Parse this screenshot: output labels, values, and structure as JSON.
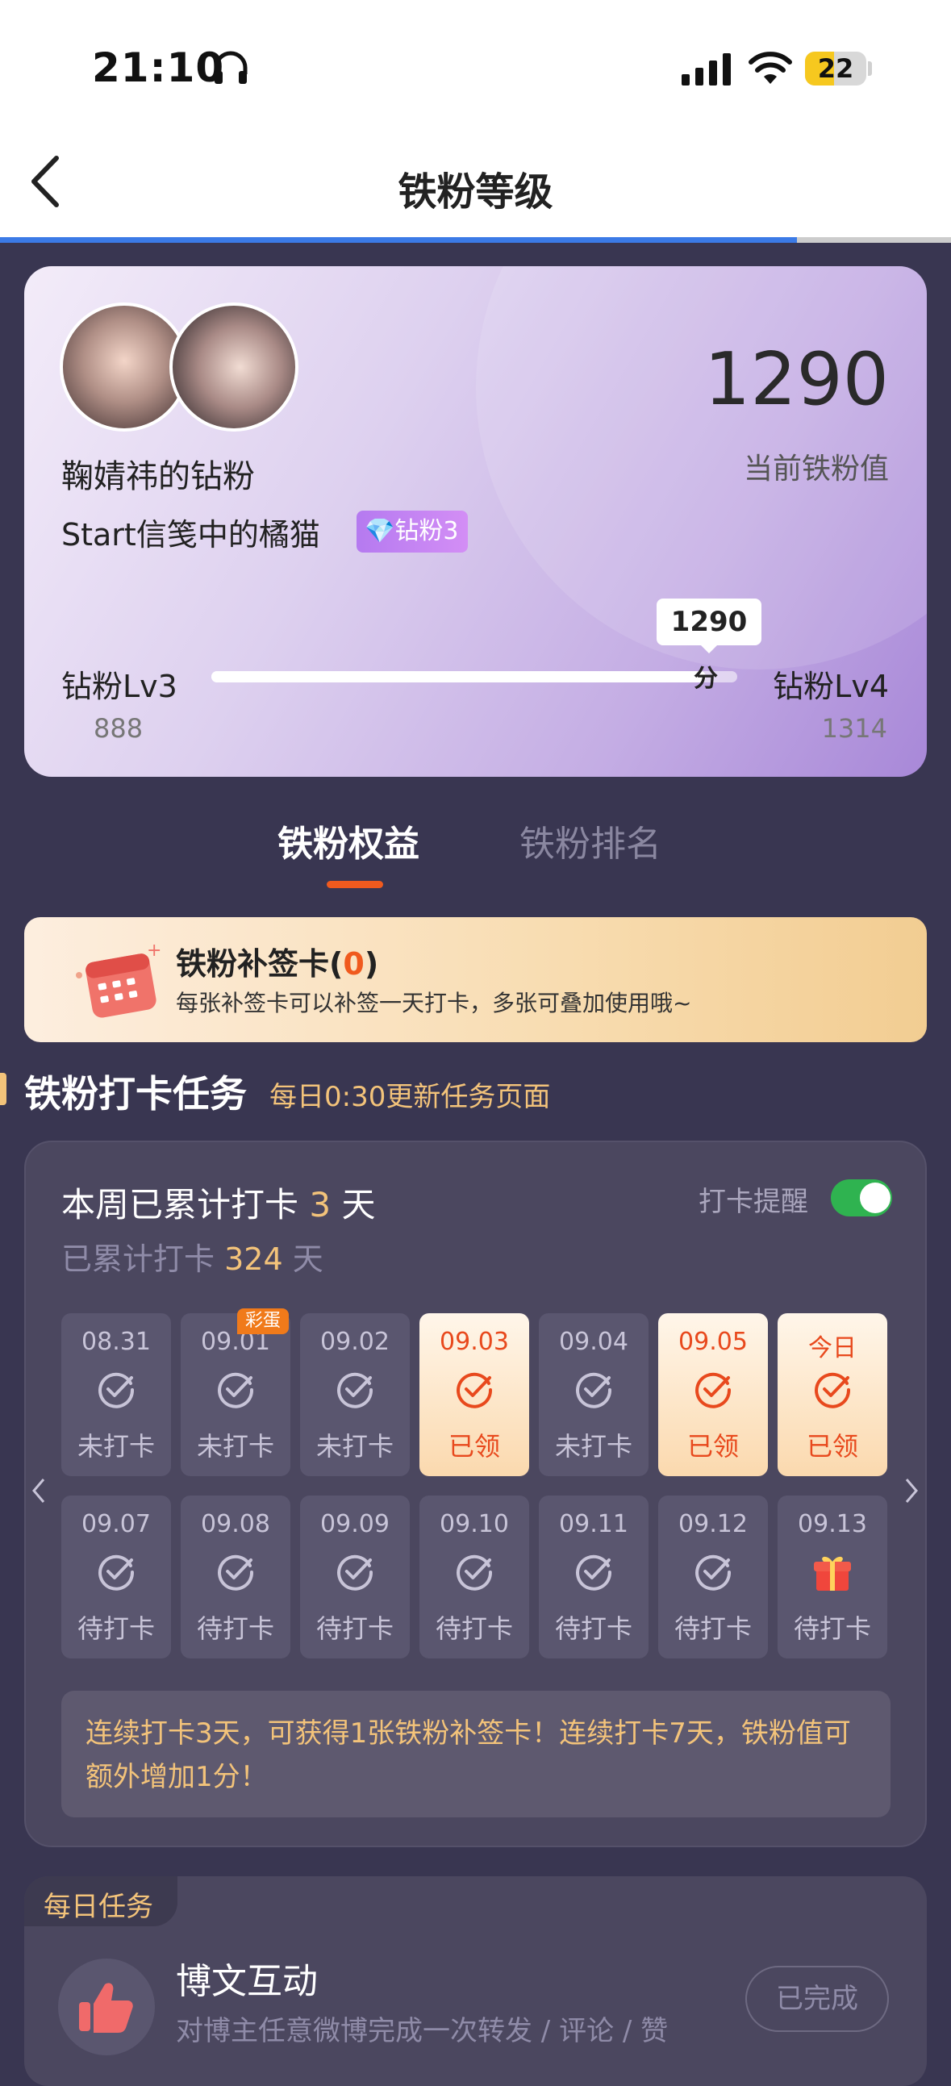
{
  "status_bar": {
    "time": "21:10",
    "battery": "22"
  },
  "nav": {
    "title": "铁粉等级"
  },
  "hero": {
    "name": "鞠婧祎的钻粉",
    "username": "Start信笺中的橘猫",
    "badge": "钻粉3",
    "score": "1290",
    "score_label": "当前铁粉值",
    "level_current": "钻粉Lv3",
    "level_next": "钻粉Lv4",
    "level_current_value": "888",
    "level_next_value": "1314",
    "bubble_value": "1290",
    "bubble_unit": "分",
    "progress": 0.94
  },
  "tabs": [
    {
      "label": "铁粉权益"
    },
    {
      "label": "铁粉排名"
    }
  ],
  "signin_card": {
    "title": "铁粉补签卡",
    "count": "0",
    "desc": "每张补签卡可以补签一天打卡，多张可叠加使用哦~"
  },
  "section": {
    "title": "铁粉打卡任务",
    "subtitle": "每日0:30更新任务页面"
  },
  "checkin": {
    "week_prefix": "本周已累计打卡",
    "week_count": "3",
    "week_suffix": "天",
    "total_prefix": "已累计打卡",
    "total_count": "324",
    "total_suffix": "天",
    "reminder_label": "打卡提醒",
    "reminder_on": true,
    "egg_label": "彩蛋",
    "week1": [
      {
        "date": "08.31",
        "status": "未打卡",
        "state": "missed"
      },
      {
        "date": "09.01",
        "status": "未打卡",
        "state": "missed"
      },
      {
        "date": "09.02",
        "status": "未打卡",
        "state": "missed"
      },
      {
        "date": "09.03",
        "status": "已领",
        "state": "claimed"
      },
      {
        "date": "09.04",
        "status": "未打卡",
        "state": "missed"
      },
      {
        "date": "09.05",
        "status": "已领",
        "state": "claimed"
      },
      {
        "date": "今日",
        "status": "已领",
        "state": "claimed"
      }
    ],
    "week2": [
      {
        "date": "09.07",
        "status": "待打卡",
        "state": "pending"
      },
      {
        "date": "09.08",
        "status": "待打卡",
        "state": "pending"
      },
      {
        "date": "09.09",
        "status": "待打卡",
        "state": "pending"
      },
      {
        "date": "09.10",
        "status": "待打卡",
        "state": "pending"
      },
      {
        "date": "09.11",
        "status": "待打卡",
        "state": "pending"
      },
      {
        "date": "09.12",
        "status": "待打卡",
        "state": "pending"
      },
      {
        "date": "09.13",
        "status": "待打卡",
        "state": "gift"
      }
    ],
    "tip": "连续打卡3天，可获得1张铁粉补签卡！连续打卡7天，铁粉值可额外增加1分！"
  },
  "daily": {
    "tag": "每日任务",
    "task_title": "博文互动",
    "task_desc": "对博主任意微博完成一次转发 / 评论 / 赞",
    "button": "已完成"
  },
  "colors": {
    "accent": "#f05a1e",
    "gold": "#f3c37a",
    "background": "#393651",
    "toggle": "#2fb350"
  }
}
